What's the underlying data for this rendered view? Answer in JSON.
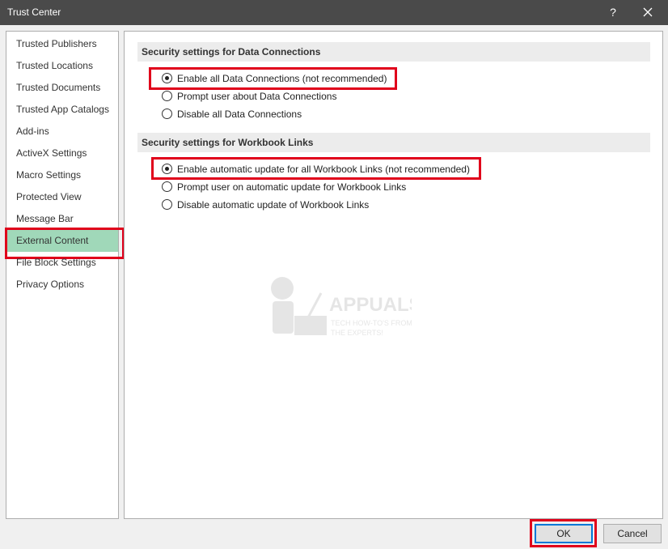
{
  "window": {
    "title": "Trust Center",
    "help": "?",
    "close": "close"
  },
  "sidebar": {
    "items": [
      {
        "label": "Trusted Publishers"
      },
      {
        "label": "Trusted Locations"
      },
      {
        "label": "Trusted Documents"
      },
      {
        "label": "Trusted App Catalogs"
      },
      {
        "label": "Add-ins"
      },
      {
        "label": "ActiveX Settings"
      },
      {
        "label": "Macro Settings"
      },
      {
        "label": "Protected View"
      },
      {
        "label": "Message Bar"
      },
      {
        "label": "External Content",
        "selected": true
      },
      {
        "label": "File Block Settings"
      },
      {
        "label": "Privacy Options"
      }
    ]
  },
  "data_connections": {
    "header": "Security settings for Data Connections",
    "options": [
      {
        "label": "Enable all Data Connections (not recommended)",
        "checked": true
      },
      {
        "label": "Prompt user about Data Connections",
        "checked": false
      },
      {
        "label": "Disable all Data Connections",
        "checked": false
      }
    ]
  },
  "workbook_links": {
    "header": "Security settings for Workbook Links",
    "options": [
      {
        "label": "Enable automatic update for all Workbook Links (not recommended)",
        "checked": true
      },
      {
        "label": "Prompt user on automatic update for Workbook Links",
        "checked": false
      },
      {
        "label": "Disable automatic update of Workbook Links",
        "checked": false
      }
    ]
  },
  "watermark": {
    "brand": "APPUALS",
    "tagline_1": "TECH HOW-TO'S FROM",
    "tagline_2": "THE EXPERTS!"
  },
  "buttons": {
    "ok": "OK",
    "cancel": "Cancel"
  },
  "colors": {
    "titlebar": "#4a4a4a",
    "selected": "#a0d8b9",
    "highlight": "#e0001b",
    "focus": "#0078d7"
  }
}
